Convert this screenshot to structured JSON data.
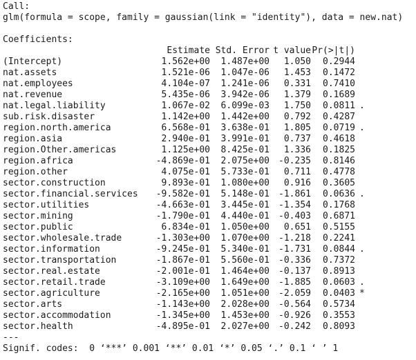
{
  "call_label": "Call:",
  "call_text": "glm(formula = scope, family = gaussian(link = \"identity\"), data = new.nat)",
  "coef_label": "Coefficients:",
  "headers": {
    "estimate": "Estimate",
    "stderr": "Std. Error",
    "tvalue": "t value",
    "pvalue": "Pr(>|t|)"
  },
  "rows": [
    {
      "name": "(Intercept)",
      "est": "1.562e+00",
      "se": "1.487e+00",
      "t": "1.050",
      "p": "0.2944",
      "sig": ""
    },
    {
      "name": "nat.assets",
      "est": "1.521e-06",
      "se": "1.047e-06",
      "t": "1.453",
      "p": "0.1472",
      "sig": ""
    },
    {
      "name": "nat.employees",
      "est": "4.104e-07",
      "se": "1.241e-06",
      "t": "0.331",
      "p": "0.7410",
      "sig": ""
    },
    {
      "name": "nat.revenue",
      "est": "5.435e-06",
      "se": "3.942e-06",
      "t": "1.379",
      "p": "0.1689",
      "sig": ""
    },
    {
      "name": "nat.legal.liability",
      "est": "1.067e-02",
      "se": "6.099e-03",
      "t": "1.750",
      "p": "0.0811",
      "sig": "."
    },
    {
      "name": "sub.risk.disaster",
      "est": "1.142e+00",
      "se": "1.442e+00",
      "t": "0.792",
      "p": "0.4287",
      "sig": ""
    },
    {
      "name": "region.north.america",
      "est": "6.568e-01",
      "se": "3.638e-01",
      "t": "1.805",
      "p": "0.0719",
      "sig": "."
    },
    {
      "name": "region.asia",
      "est": "2.940e-01",
      "se": "3.991e-01",
      "t": "0.737",
      "p": "0.4618",
      "sig": ""
    },
    {
      "name": "region.Other.americas",
      "est": "1.125e+00",
      "se": "8.425e-01",
      "t": "1.336",
      "p": "0.1825",
      "sig": ""
    },
    {
      "name": "region.africa",
      "est": "-4.869e-01",
      "se": "2.075e+00",
      "t": "-0.235",
      "p": "0.8146",
      "sig": ""
    },
    {
      "name": "region.other",
      "est": "4.075e-01",
      "se": "5.733e-01",
      "t": "0.711",
      "p": "0.4778",
      "sig": ""
    },
    {
      "name": "sector.construction",
      "est": "9.893e-01",
      "se": "1.080e+00",
      "t": "0.916",
      "p": "0.3605",
      "sig": ""
    },
    {
      "name": "sector.financial.services",
      "est": "-9.582e-01",
      "se": "5.148e-01",
      "t": "-1.861",
      "p": "0.0636",
      "sig": "."
    },
    {
      "name": "sector.utilities",
      "est": "-4.663e-01",
      "se": "3.445e-01",
      "t": "-1.354",
      "p": "0.1768",
      "sig": ""
    },
    {
      "name": "sector.mining",
      "est": "-1.790e-01",
      "se": "4.440e-01",
      "t": "-0.403",
      "p": "0.6871",
      "sig": ""
    },
    {
      "name": "sector.public",
      "est": "6.834e-01",
      "se": "1.050e+00",
      "t": "0.651",
      "p": "0.5155",
      "sig": ""
    },
    {
      "name": "sector.wholesale.trade",
      "est": "-1.303e+00",
      "se": "1.070e+00",
      "t": "-1.218",
      "p": "0.2241",
      "sig": ""
    },
    {
      "name": "sector.information",
      "est": "-9.245e-01",
      "se": "5.340e-01",
      "t": "-1.731",
      "p": "0.0844",
      "sig": "."
    },
    {
      "name": "sector.transportation",
      "est": "-1.867e-01",
      "se": "5.560e-01",
      "t": "-0.336",
      "p": "0.7372",
      "sig": ""
    },
    {
      "name": "sector.real.estate",
      "est": "-2.001e-01",
      "se": "1.464e+00",
      "t": "-0.137",
      "p": "0.8913",
      "sig": ""
    },
    {
      "name": "sector.retail.trade",
      "est": "-3.109e+00",
      "se": "1.649e+00",
      "t": "-1.885",
      "p": "0.0603",
      "sig": "."
    },
    {
      "name": "sector.agriculture",
      "est": "-2.165e+00",
      "se": "1.051e+00",
      "t": "-2.059",
      "p": "0.0403",
      "sig": "*"
    },
    {
      "name": "sector.arts",
      "est": "-1.143e+00",
      "se": "2.028e+00",
      "t": "-0.564",
      "p": "0.5734",
      "sig": ""
    },
    {
      "name": "sector.accommodation",
      "est": "-1.345e+00",
      "se": "1.453e+00",
      "t": "-0.926",
      "p": "0.3553",
      "sig": ""
    },
    {
      "name": "sector.health",
      "est": "-4.895e-01",
      "se": "2.027e+00",
      "t": "-0.242",
      "p": "0.8093",
      "sig": ""
    }
  ],
  "separator": "---",
  "signif_codes": "Signif. codes:  0 ‘***’ 0.001 ‘**’ 0.01 ‘*’ 0.05 ‘.’ 0.1 ‘ ’ 1"
}
